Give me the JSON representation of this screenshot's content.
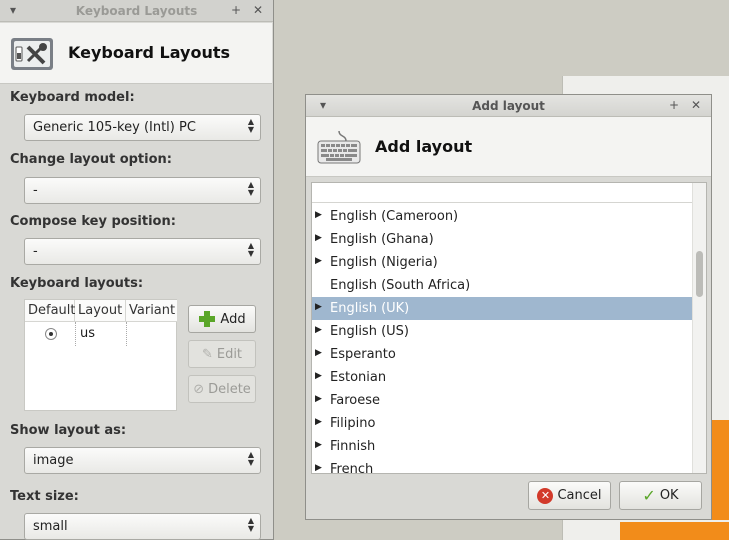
{
  "main_window": {
    "title": "Keyboard Layouts",
    "header_title": "Keyboard Layouts",
    "keyboard_model_label": "Keyboard model:",
    "keyboard_model_value": "Generic 105-key (Intl) PC",
    "change_layout_label": "Change layout option:",
    "change_layout_value": "-",
    "compose_key_label": "Compose key position:",
    "compose_key_value": "-",
    "keyboard_layouts_label": "Keyboard layouts:",
    "table": {
      "columns": [
        "Default",
        "Layout",
        "Variant"
      ],
      "rows": [
        {
          "default": true,
          "layout": "us",
          "variant": ""
        }
      ]
    },
    "buttons": {
      "add": "Add",
      "edit": "Edit",
      "delete": "Delete"
    },
    "show_layout_label": "Show layout as:",
    "show_layout_value": "image",
    "text_size_label": "Text size:",
    "text_size_value": "small"
  },
  "dialog": {
    "title": "Add layout",
    "header_title": "Add layout",
    "items": [
      {
        "label": "English (Cameroon)",
        "expandable": true,
        "selected": false
      },
      {
        "label": "English (Ghana)",
        "expandable": true,
        "selected": false
      },
      {
        "label": "English (Nigeria)",
        "expandable": true,
        "selected": false
      },
      {
        "label": "English (South Africa)",
        "expandable": false,
        "selected": false
      },
      {
        "label": "English (UK)",
        "expandable": true,
        "selected": true
      },
      {
        "label": "English (US)",
        "expandable": true,
        "selected": false
      },
      {
        "label": "Esperanto",
        "expandable": true,
        "selected": false
      },
      {
        "label": "Estonian",
        "expandable": true,
        "selected": false
      },
      {
        "label": "Faroese",
        "expandable": true,
        "selected": false
      },
      {
        "label": "Filipino",
        "expandable": true,
        "selected": false
      },
      {
        "label": "Finnish",
        "expandable": true,
        "selected": false
      },
      {
        "label": "French",
        "expandable": true,
        "selected": false
      }
    ],
    "cancel_label": "Cancel",
    "ok_label": "OK"
  },
  "colors": {
    "selection": "#9fb7cf",
    "accent_green": "#5aa628",
    "cancel_red": "#d23a2a"
  }
}
